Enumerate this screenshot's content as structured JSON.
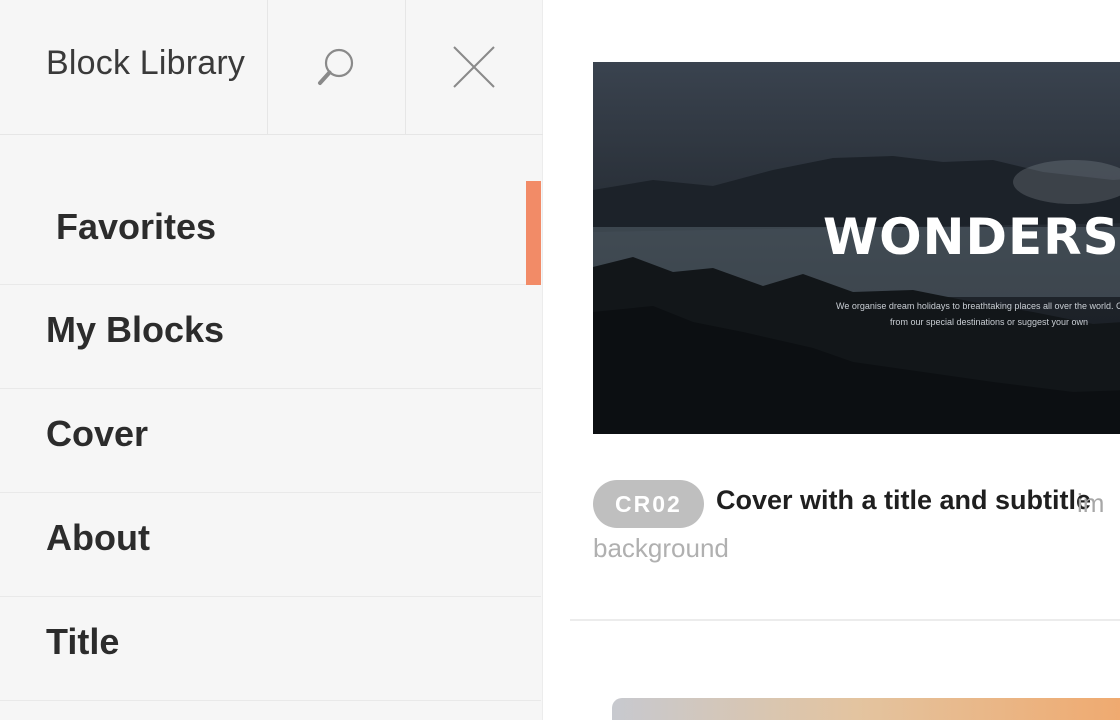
{
  "sidebar": {
    "title": "Block Library",
    "icons": {
      "search": "search-icon",
      "close": "close-icon"
    },
    "items": [
      {
        "label": "Favorites",
        "active": true
      },
      {
        "label": "My Blocks"
      },
      {
        "label": "Cover"
      },
      {
        "label": "About"
      },
      {
        "label": "Title"
      }
    ]
  },
  "colors": {
    "active_indicator": "#f28b67",
    "code_badge": "#bfbfbf",
    "sidebar_bg": "#f6f6f6"
  },
  "card": {
    "preview": {
      "heading": "WONDERS",
      "subtitle_line1": "We organise dream holidays to breathtaking places all over the world. Choos",
      "subtitle_line2": "from our special destinations or suggest your own"
    },
    "code": "CR02",
    "title": "Cover with a title and subtitle",
    "description_part1": "im",
    "description_part2": "background"
  }
}
